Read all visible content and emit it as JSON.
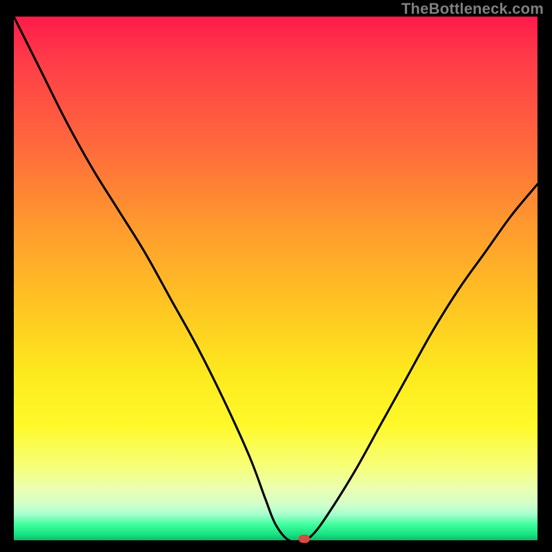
{
  "watermark": "TheBottleneck.com",
  "chart_data": {
    "type": "line",
    "title": "",
    "xlabel": "",
    "ylabel": "",
    "x": [
      0.0,
      0.05,
      0.1,
      0.15,
      0.2,
      0.25,
      0.3,
      0.35,
      0.4,
      0.45,
      0.48,
      0.5,
      0.525,
      0.55,
      0.57,
      0.6,
      0.65,
      0.7,
      0.75,
      0.8,
      0.85,
      0.9,
      0.95,
      1.0
    ],
    "values": [
      1.0,
      0.9,
      0.8,
      0.71,
      0.63,
      0.55,
      0.46,
      0.37,
      0.27,
      0.16,
      0.08,
      0.03,
      0.0,
      0.0,
      0.01,
      0.05,
      0.13,
      0.22,
      0.31,
      0.4,
      0.48,
      0.55,
      0.62,
      0.68
    ],
    "xlim": [
      0,
      1
    ],
    "ylim": [
      0,
      1
    ],
    "marker": {
      "x": 0.555,
      "y": 0.003
    },
    "background": "red-yellow-green vertical gradient",
    "axes_visible": false,
    "grid": false
  }
}
